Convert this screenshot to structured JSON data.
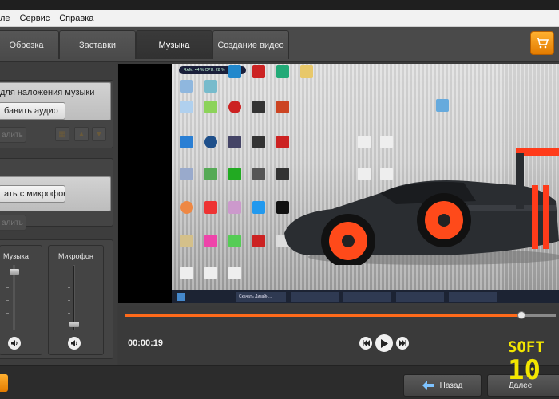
{
  "menu": {
    "items": [
      "ле",
      "Сервис",
      "Справка"
    ]
  },
  "tabs": [
    {
      "label": "Обрезка",
      "active": false
    },
    {
      "label": "Заставки",
      "active": false
    },
    {
      "label": "Музыка",
      "active": true
    },
    {
      "label": "Создание видео",
      "active": false
    }
  ],
  "left": {
    "music_section_label": "для наложения музыки",
    "add_audio_label": "бавить аудио",
    "delete_label_1": "алить",
    "mic_button_label": "ать с микрофона",
    "delete_label_2": "алить",
    "music_volume_label": "Музыка",
    "mic_volume_label": "Микрофон",
    "music_volume_level": 0.9,
    "mic_volume_level": 0.1
  },
  "preview": {
    "sysmon_text": "RAM: 44 %  CPU: 28 %",
    "shortcut_text": "Скачать Дизайн..."
  },
  "timeline": {
    "position_fraction": 0.92,
    "time": "00:00:19"
  },
  "bottom": {
    "back_label": "Назад",
    "next_label": "Далее"
  },
  "watermark": {
    "line1": "SOFT",
    "line2": "10"
  },
  "colors": {
    "accent": "#ff6a1a",
    "cart_orange": "#f29200"
  }
}
